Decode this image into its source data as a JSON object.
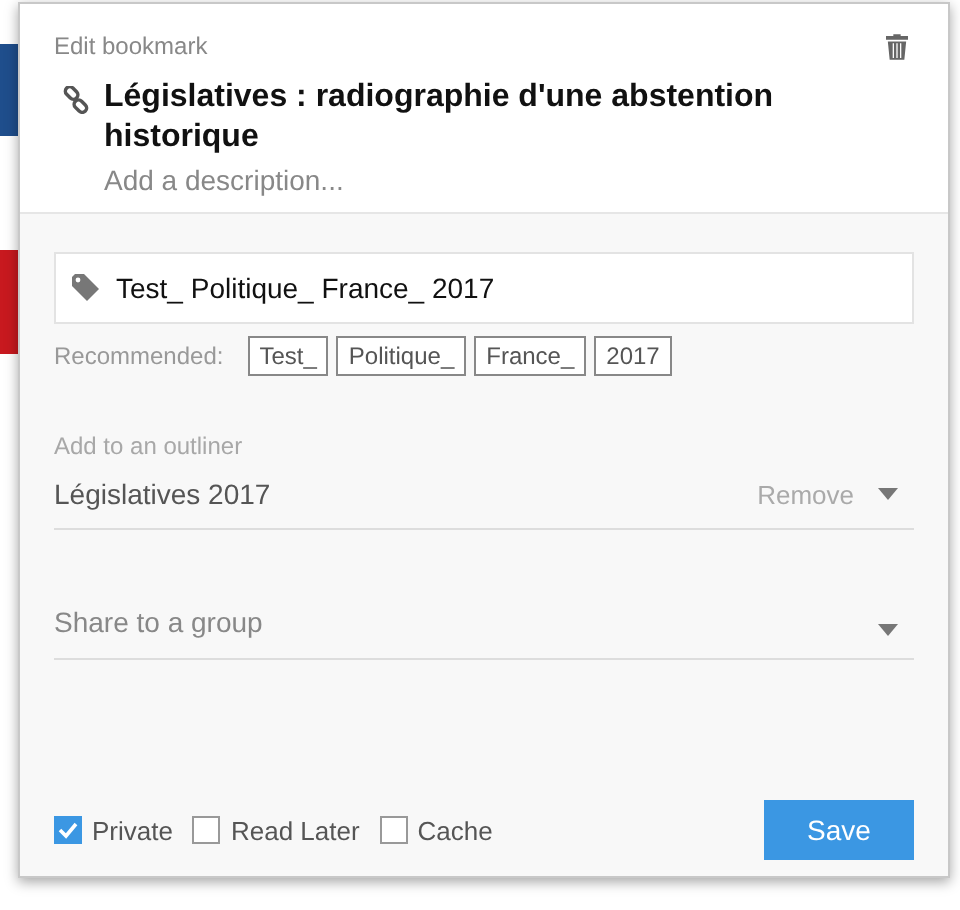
{
  "dialog": {
    "heading": "Edit bookmark",
    "title": "Législatives : radiographie d'une abstention historique",
    "description": {
      "placeholder": "Add a description..."
    },
    "tags": {
      "value": "Test_ Politique_ France_ 2017",
      "recommended_label": "Recommended:",
      "recommended": [
        "Test_",
        "Politique_",
        "France_",
        "2017"
      ]
    },
    "outliner": {
      "label": "Add to an outliner",
      "value": "Législatives 2017",
      "remove": "Remove"
    },
    "group": {
      "placeholder": "Share to a group"
    },
    "options": [
      {
        "label": "Private",
        "checked": true
      },
      {
        "label": "Read Later",
        "checked": false
      },
      {
        "label": "Cache",
        "checked": false
      }
    ],
    "save": "Save"
  }
}
